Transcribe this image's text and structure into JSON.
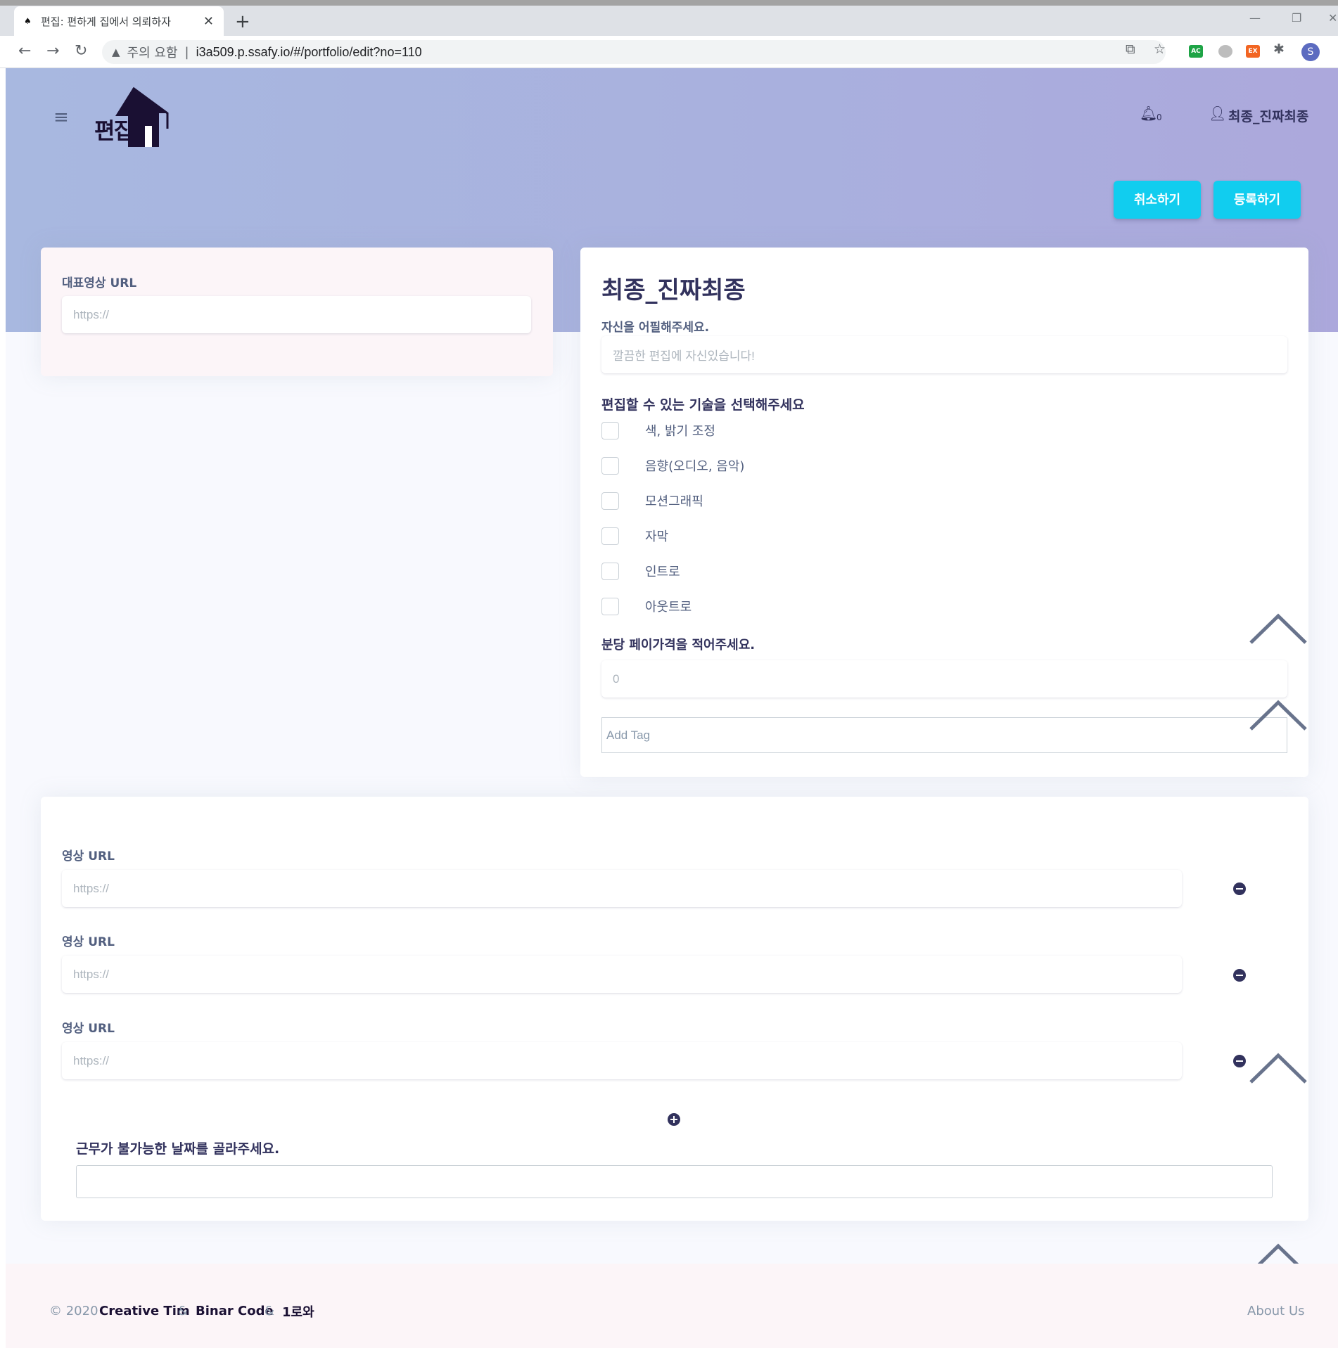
{
  "browser": {
    "tab_title": "편집: 편하게 집에서 의뢰하자",
    "security_label": "주의 요함",
    "url": "i3a509.p.ssafy.io/#/portfolio/edit?no=110",
    "profile_initial": "S",
    "ext_ac": "AC",
    "ext_ex": "EX"
  },
  "header": {
    "logo_text": "편집",
    "notification_count": "0",
    "user_name": "최종_진짜최종",
    "cancel_label": "취소하기",
    "submit_label": "등록하기"
  },
  "left_card": {
    "main_video_label": "대표영상 URL",
    "main_video_placeholder": "https://"
  },
  "right_card": {
    "title": "최종_진짜최종",
    "appeal_label": "자신을 어필해주세요.",
    "appeal_placeholder": "깔끔한 편집에 자신있습니다!",
    "skills_label": "편집할 수 있는 기술을 선택해주세요",
    "skills": [
      {
        "label": "색, 밝기 조정",
        "checked": false
      },
      {
        "label": "음향(오디오, 음악)",
        "checked": false
      },
      {
        "label": "모션그래픽",
        "checked": false
      },
      {
        "label": "자막",
        "checked": false
      },
      {
        "label": "인트로",
        "checked": false
      },
      {
        "label": "아웃트로",
        "checked": false
      }
    ],
    "price_label": "분당 페이가격을 적어주세요.",
    "price_value": "0",
    "tag_placeholder": "Add Tag"
  },
  "bottom_card": {
    "video_urls": [
      {
        "label": "영상 URL",
        "placeholder": "https://"
      },
      {
        "label": "영상 URL",
        "placeholder": "https://"
      },
      {
        "label": "영상 URL",
        "placeholder": "https://"
      }
    ],
    "unavailable_label": "근무가 불가능한 날짜를 골라주세요."
  },
  "footer": {
    "copyright": "© 2020",
    "credit1": "Creative Tim",
    "amp": "&",
    "credit2": "Binar Code",
    "credit3": "1로와",
    "about": "About Us"
  },
  "colors": {
    "accent": "#11cdef",
    "text_dark": "#32325d",
    "text_muted": "#525f7f"
  },
  "icons": [
    "back-icon",
    "forward-icon",
    "reload-icon",
    "warning-icon",
    "translate-icon",
    "star-icon",
    "extensions-icon",
    "hamburger-icon",
    "bell-icon",
    "user-icon",
    "minus-circle-icon",
    "plus-circle-icon",
    "chevron-up-icon"
  ]
}
